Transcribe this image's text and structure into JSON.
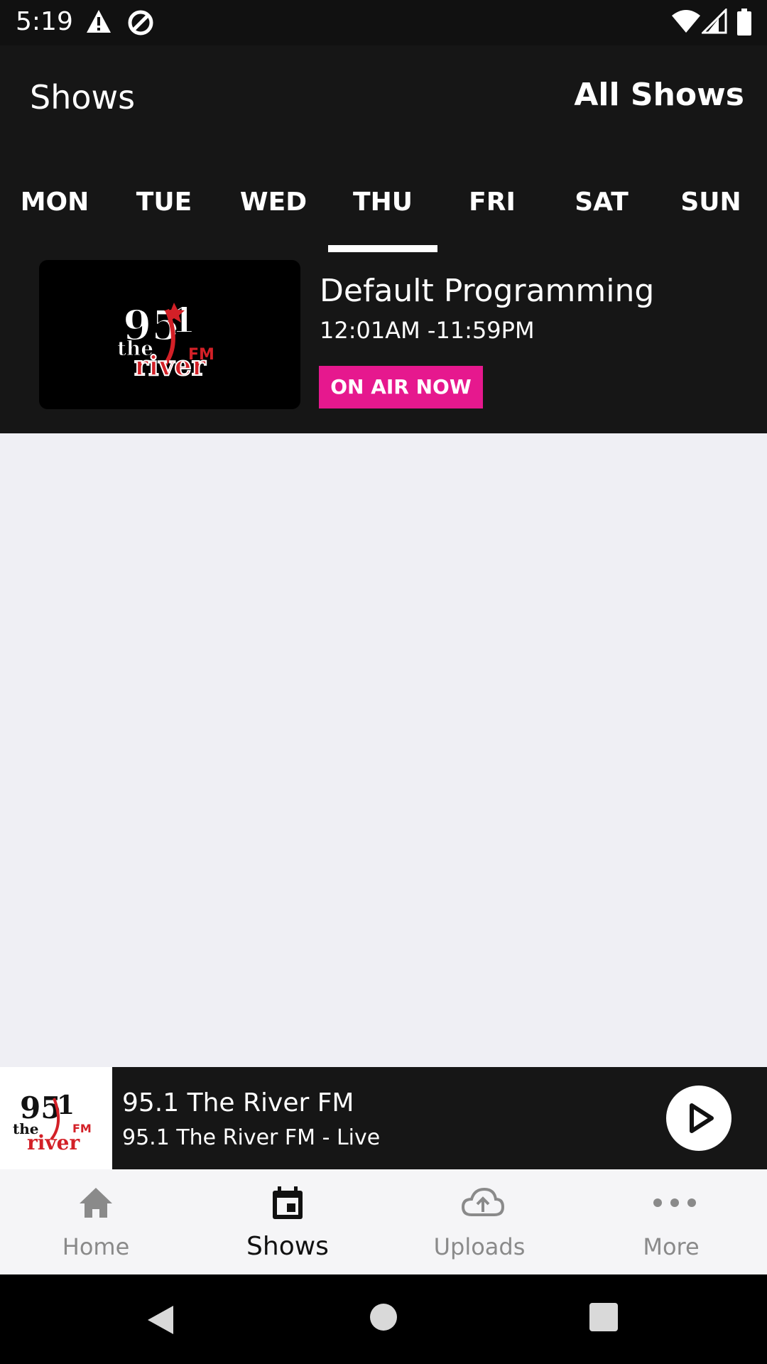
{
  "status_bar": {
    "time": "5:19"
  },
  "header": {
    "title": "Shows",
    "all_shows_label": "All Shows"
  },
  "day_tabs": [
    "MON",
    "TUE",
    "WED",
    "THU",
    "FRI",
    "SAT",
    "SUN"
  ],
  "selected_day": "THU",
  "show": {
    "title": "Default Programming",
    "time": "12:01AM -11:59PM",
    "badge": "ON AIR NOW",
    "logo_text": "95.1 FM the river"
  },
  "player": {
    "title": "95.1 The River FM",
    "subtitle": "95.1 The River FM - Live"
  },
  "nav": {
    "home_label": "Home",
    "shows_label": "Shows",
    "uploads_label": "Uploads",
    "more_label": "More"
  },
  "colors": {
    "header_bg": "#161616",
    "accent_badge": "#e6188e",
    "body_bg": "#efeff4",
    "logo_red": "#d32027"
  }
}
